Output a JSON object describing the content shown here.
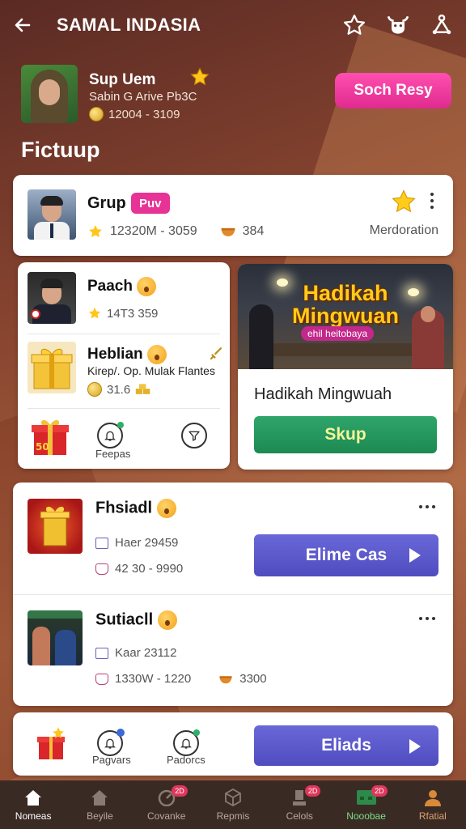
{
  "header": {
    "title": "SAMAL INDASIA"
  },
  "profile": {
    "name": "Sup Uem",
    "subtitle": "Sabin G Arive Pb3C",
    "coins": "12004 - 3109",
    "action_button": "Soch Resy"
  },
  "section_title": "Fictuup",
  "group_card": {
    "name": "Grup",
    "badge": "Puv",
    "stats_left": "12320M - 3059",
    "stats_right": "384",
    "role": "Merdoration"
  },
  "list_card": {
    "items": [
      {
        "name": "Paach",
        "stat": "14T3 359"
      },
      {
        "name": "Heblian",
        "desc": "Kirep/. Op. Mulak Flantes",
        "stat": "31.6"
      }
    ],
    "footer_label": "Feepas"
  },
  "promo": {
    "headline_line1": "Hadikah",
    "headline_line2": "Mingwuan",
    "image_caption": "ehil heitobaya",
    "title": "Hadikah Mingwuah",
    "button_label": "Skup"
  },
  "games": [
    {
      "name": "Fhsiadl",
      "stat1": "Haer 29459",
      "stat2": "42 30 - 9990",
      "button_label": "Elime Cas"
    },
    {
      "name": "Sutiacll",
      "stat1": "Kaar 23112",
      "stat2": "1330W - 1220",
      "stat3": "3300"
    }
  ],
  "action_card": {
    "label_left": "Pagvars",
    "label_right": "Padorcs",
    "button_label": "Eliads"
  },
  "bottom_nav": [
    {
      "label": "Nomeas",
      "icon": "home-icon",
      "active": true
    },
    {
      "label": "Beyile",
      "icon": "house-icon"
    },
    {
      "label": "Covanke",
      "icon": "gauge-icon",
      "badge": "2D"
    },
    {
      "label": "Repmis",
      "icon": "cube-icon"
    },
    {
      "label": "Celols",
      "icon": "trophy-icon",
      "badge": "2D"
    },
    {
      "label": "Nooobae",
      "icon": "grid-icon",
      "badge": "2D"
    },
    {
      "label": "Rfatial",
      "icon": "user-icon"
    }
  ],
  "colors": {
    "pink": "#e73296",
    "green": "#1c8a52",
    "purple": "#5b58cc",
    "background": "#8a4630"
  }
}
